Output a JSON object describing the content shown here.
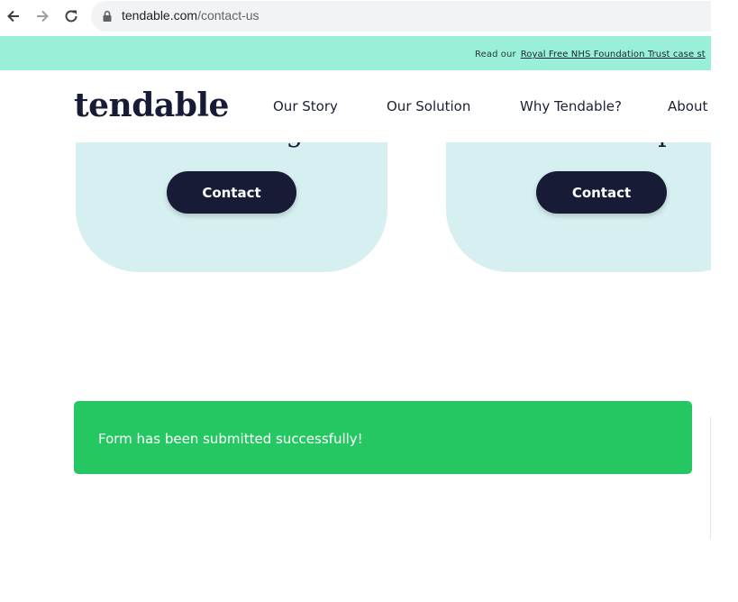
{
  "browser": {
    "url_domain": "tendable.com",
    "url_path": "/contact-us",
    "back_icon": "arrow-left-icon",
    "forward_icon": "arrow-right-icon",
    "reload_icon": "reload-icon",
    "lock_icon": "lock-icon"
  },
  "announcement": {
    "prefix": "Read our",
    "link": "Royal Free NHS Foundation Trust case st"
  },
  "header": {
    "logo": "tendable",
    "nav": [
      "Our Story",
      "Our Solution",
      "Why Tendable?",
      "About"
    ]
  },
  "cards": [
    {
      "title": "Marketing",
      "button": "Contact"
    },
    {
      "title": "Partnerships",
      "button": "Contact"
    }
  ],
  "success_message": "Form has been submitted successfully!",
  "colors": {
    "announce_bg": "#9aefd8",
    "brand_navy": "#181b35",
    "card_bg": "#d6f0f1",
    "success_green": "#24c762"
  }
}
